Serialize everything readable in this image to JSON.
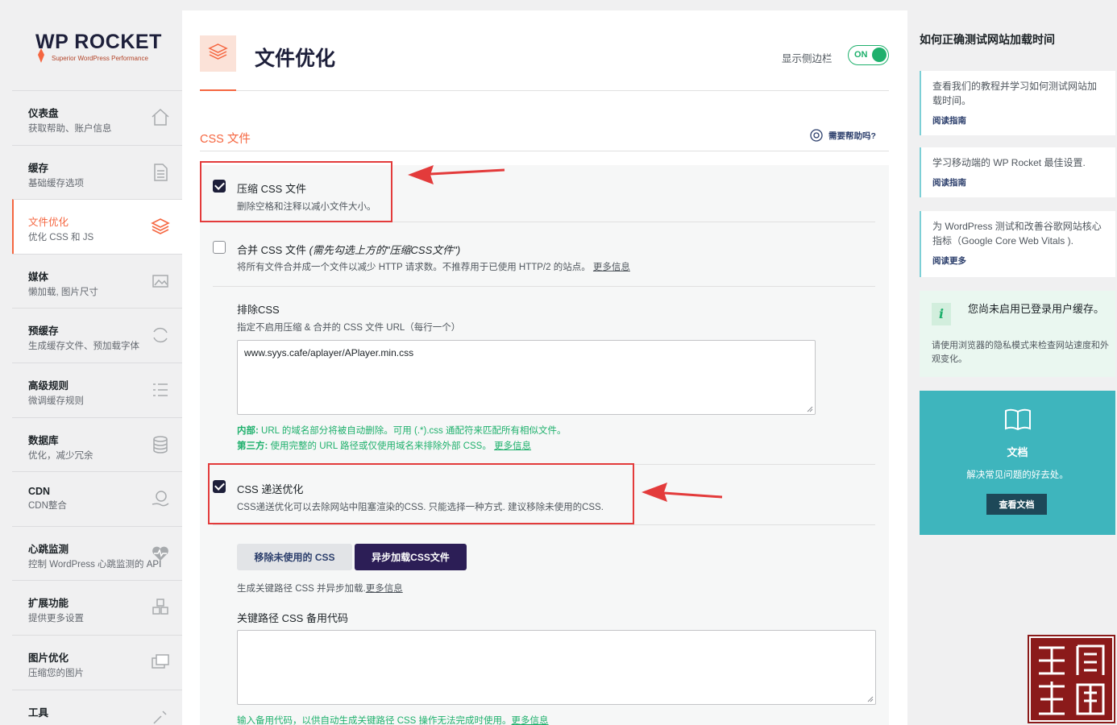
{
  "brand": {
    "logo_wp": "WP",
    "logo_rocket": "ROCKET",
    "logo_tagline": "Superior WordPress Performance",
    "accent": "#f56640",
    "green": "#1eb06c",
    "dark": "#1d1f3a"
  },
  "nav": [
    {
      "title": "仪表盘",
      "sub": "获取帮助、账户信息",
      "icon": "house-icon"
    },
    {
      "title": "缓存",
      "sub": "基础缓存选项",
      "icon": "document-icon"
    },
    {
      "title": "文件优化",
      "sub": "优化 CSS 和 JS",
      "icon": "layers-icon",
      "active": true
    },
    {
      "title": "媒体",
      "sub": "懒加载, 图片尺寸",
      "icon": "image-icon"
    },
    {
      "title": "预缓存",
      "sub": "生成缓存文件、预加载字体",
      "icon": "refresh-icon"
    },
    {
      "title": "高级规则",
      "sub": "微调缓存规则",
      "icon": "list-icon"
    },
    {
      "title": "数据库",
      "sub": "优化，减少冗余",
      "icon": "database-icon"
    },
    {
      "title": "CDN",
      "sub": "CDN整合",
      "icon": "globe-hand-icon"
    },
    {
      "title": "心跳监测",
      "sub": "控制 WordPress 心跳监测的 API",
      "icon": "heartbeat-icon"
    },
    {
      "title": "扩展功能",
      "sub": "提供更多设置",
      "icon": "cubes-icon"
    },
    {
      "title": "图片优化",
      "sub": "压缩您的图片",
      "icon": "images-icon"
    },
    {
      "title": "工具",
      "sub": "",
      "icon": "tools-icon"
    }
  ],
  "header": {
    "title": "文件优化",
    "sidebar_toggle_label": "显示侧边栏",
    "toggle_state": "ON"
  },
  "section": {
    "title": "CSS 文件",
    "help": "需要帮助吗?"
  },
  "options": {
    "minify": {
      "label": "压缩 CSS 文件",
      "desc": "删除空格和注释以减小文件大小。",
      "checked": true
    },
    "combine": {
      "label": "合并 CSS 文件",
      "note": "(需先勾选上方的\"压缩CSS文件\")",
      "desc": "将所有文件合并成一个文件以减少 HTTP 请求数。不推荐用于已使用 HTTP/2 的站点。",
      "more": "更多信息",
      "checked": false
    },
    "exclude": {
      "label": "排除CSS",
      "desc": "指定不启用压缩 & 合并的 CSS 文件 URL（每行一个）",
      "value": "www.syys.cafe/aplayer/APlayer.min.css",
      "note1_bold": "内部:",
      "note1": " URL 的域名部分将被自动删除。可用 (.*).css 通配符来匹配所有相似文件。",
      "note2_bold": "第三方:",
      "note2": " 使用完整的 URL 路径或仅使用域名来排除外部 CSS。",
      "more": "更多信息"
    },
    "delivery": {
      "label": "CSS 递送优化",
      "desc": "CSS递送优化可以去除网站中阻塞渲染的CSS. 只能选择一种方式. 建议移除未使用的CSS.",
      "checked": true,
      "btn_remove": "移除未使用的 CSS",
      "btn_async": "异步加载CSS文件",
      "async_desc": "生成关键路径 CSS 并异步加载.",
      "async_more": "更多信息",
      "fallback_label": "关键路径 CSS 备用代码",
      "fallback_value": "",
      "fallback_note": "输入备用代码，以供自动生成关键路径 CSS 操作无法完成时使用。",
      "fallback_more": "更多信息"
    }
  },
  "right": {
    "title": "如何正确测试网站加载时间",
    "cards": [
      {
        "text": "查看我们的教程并学习如何测试网站加载时间。",
        "link": "阅读指南"
      },
      {
        "text": "学习移动端的 WP Rocket 最佳设置.",
        "link": "阅读指南"
      },
      {
        "text": "为 WordPress 测试和改善谷歌网站核心指标（Google Core Web Vitals ).",
        "link": "阅读更多"
      }
    ],
    "info": {
      "title": "您尚未启用已登录用户缓存。",
      "text": "请使用浏览器的隐私模式来检查网站速度和外观变化。"
    },
    "doc": {
      "title": "文档",
      "sub": "解决常见问题的好去处。",
      "button": "查看文档"
    }
  }
}
